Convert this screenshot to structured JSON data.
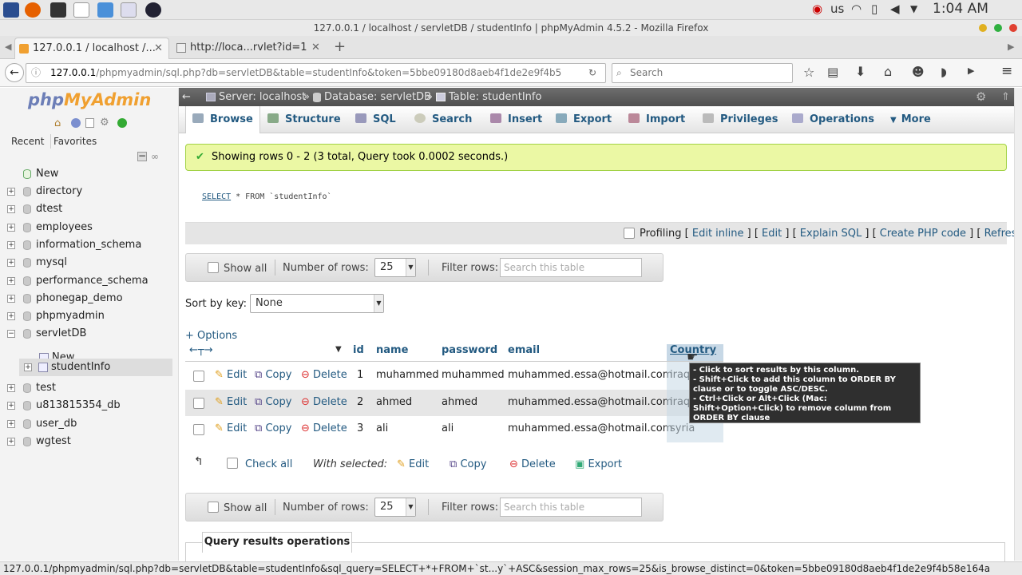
{
  "os": {
    "keyboard": "us",
    "time": "1:04 AM"
  },
  "window": {
    "title": "127.0.0.1 / localhost / servletDB / studentInfo | phpMyAdmin 4.5.2 - Mozilla Firefox"
  },
  "tabs": [
    {
      "label": "127.0.0.1 / localhost /..."
    },
    {
      "label": "http://loca...rvlet?id=1"
    }
  ],
  "nav": {
    "url_host": "127.0.0.1",
    "url_path": "/phpmyadmin/sql.php?db=servletDB&table=studentInfo&token=5bbe09180d8aeb4f1de2e9f4b5",
    "search_placeholder": "Search"
  },
  "sidebar": {
    "logo_php": "php",
    "logo_myadmin": "MyAdmin",
    "recent": "Recent",
    "favorites": "Favorites",
    "new_label": "New",
    "databases": [
      "directory",
      "dtest",
      "employees",
      "information_schema",
      "mysql",
      "performance_schema",
      "phonegap_demo",
      "phpmyadmin",
      "servletDB"
    ],
    "servlet_new": "New",
    "servlet_table": "studentInfo",
    "databases2": [
      "test",
      "u813815354_db",
      "user_db",
      "wgtest"
    ]
  },
  "breadcrumb": {
    "server": "Server: localhost",
    "database": "Database: servletDB",
    "table": "Table: studentInfo"
  },
  "menu": [
    "Browse",
    "Structure",
    "SQL",
    "Search",
    "Insert",
    "Export",
    "Import",
    "Privileges",
    "Operations",
    "More"
  ],
  "success": "Showing rows 0 - 2 (3 total, Query took 0.0002 seconds.)",
  "sql": {
    "keyword": "SELECT",
    "rest": " * FROM `studentInfo`"
  },
  "sqlbar": {
    "profiling": "Profiling",
    "edit_inline": "Edit inline",
    "edit": "Edit",
    "explain": "Explain SQL",
    "php": "Create PHP code",
    "refresh": "Refresh"
  },
  "navtable": {
    "show_all": "Show all",
    "num_rows_label": "Number of rows:",
    "num_rows": "25",
    "filter_label": "Filter rows:",
    "filter_placeholder": "Search this table"
  },
  "sort": {
    "label": "Sort by key:",
    "value": "None"
  },
  "options": "+ Options",
  "columns": [
    "id",
    "name",
    "password",
    "email",
    "Country"
  ],
  "actions": {
    "edit": "Edit",
    "copy": "Copy",
    "delete": "Delete"
  },
  "rows": [
    {
      "id": "1",
      "name": "muhammed",
      "password": "muhammed",
      "email": "muhammed.essa@hotmail.com",
      "country": "iraq"
    },
    {
      "id": "2",
      "name": "ahmed",
      "password": "ahmed",
      "email": "muhammed.essa@hotmail.com",
      "country": "iraq"
    },
    {
      "id": "3",
      "name": "ali",
      "password": "ali",
      "email": "muhammed.essa@hotmail.com",
      "country": "syria"
    }
  ],
  "tooltip": [
    "- Click to sort results by this column.",
    "- Shift+Click to add this column to ORDER BY",
    "clause or to toggle ASC/DESC.",
    "- Ctrl+Click or Alt+Click (Mac:",
    "Shift+Option+Click) to remove column from",
    "ORDER BY clause"
  ],
  "bulk": {
    "check_all": "Check all",
    "with_selected": "With selected:",
    "edit": "Edit",
    "copy": "Copy",
    "delete": "Delete",
    "export": "Export"
  },
  "qro": "Query results operations",
  "status": "127.0.0.1/phpmyadmin/sql.php?db=servletDB&table=studentInfo&sql_query=SELECT+*+FROM+`st...y`+ASC&session_max_rows=25&is_browse_distinct=0&token=5bbe09180d8aeb4f1de2e9f4b58e164a"
}
